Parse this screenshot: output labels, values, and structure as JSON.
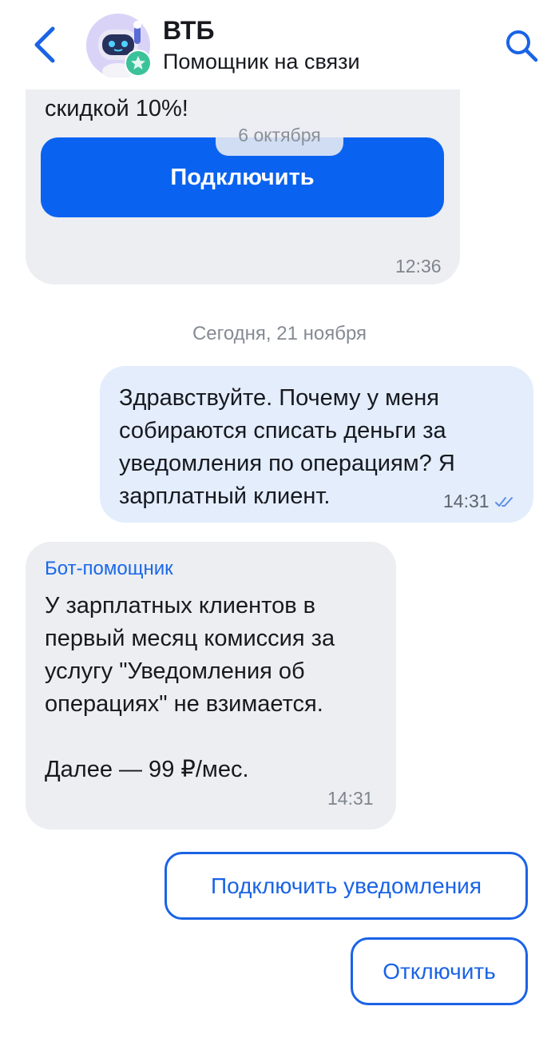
{
  "header": {
    "title": "ВТБ",
    "subtitle": "Помощник на связи",
    "back_icon": "chevron-left-icon",
    "search_icon": "search-icon",
    "accent": "#1a63e6"
  },
  "messages": {
    "promo": {
      "cut_text": "скидкой 10%!",
      "button_label": "Подключить",
      "time": "12:36",
      "date_pill": "6 октября"
    },
    "date_separator": "Сегодня, 21 ноября",
    "user": {
      "text": "Здравствуйте. Почему у меня собираются списать деньги за уведомления по операциям? Я зарплатный клиент.",
      "time": "14:31",
      "status_icon": "double-check-icon"
    },
    "bot": {
      "name": "Бот-помощник",
      "text": "У зарплатных клиентов в первый месяц комиссия за услугу \"Уведомления об операциях\" не взимается.\n\nДалее — 99 ₽/мес.",
      "time": "14:31"
    }
  },
  "quick_replies": {
    "connect_label": "Подключить уведомления",
    "disconnect_label": "Отключить"
  }
}
